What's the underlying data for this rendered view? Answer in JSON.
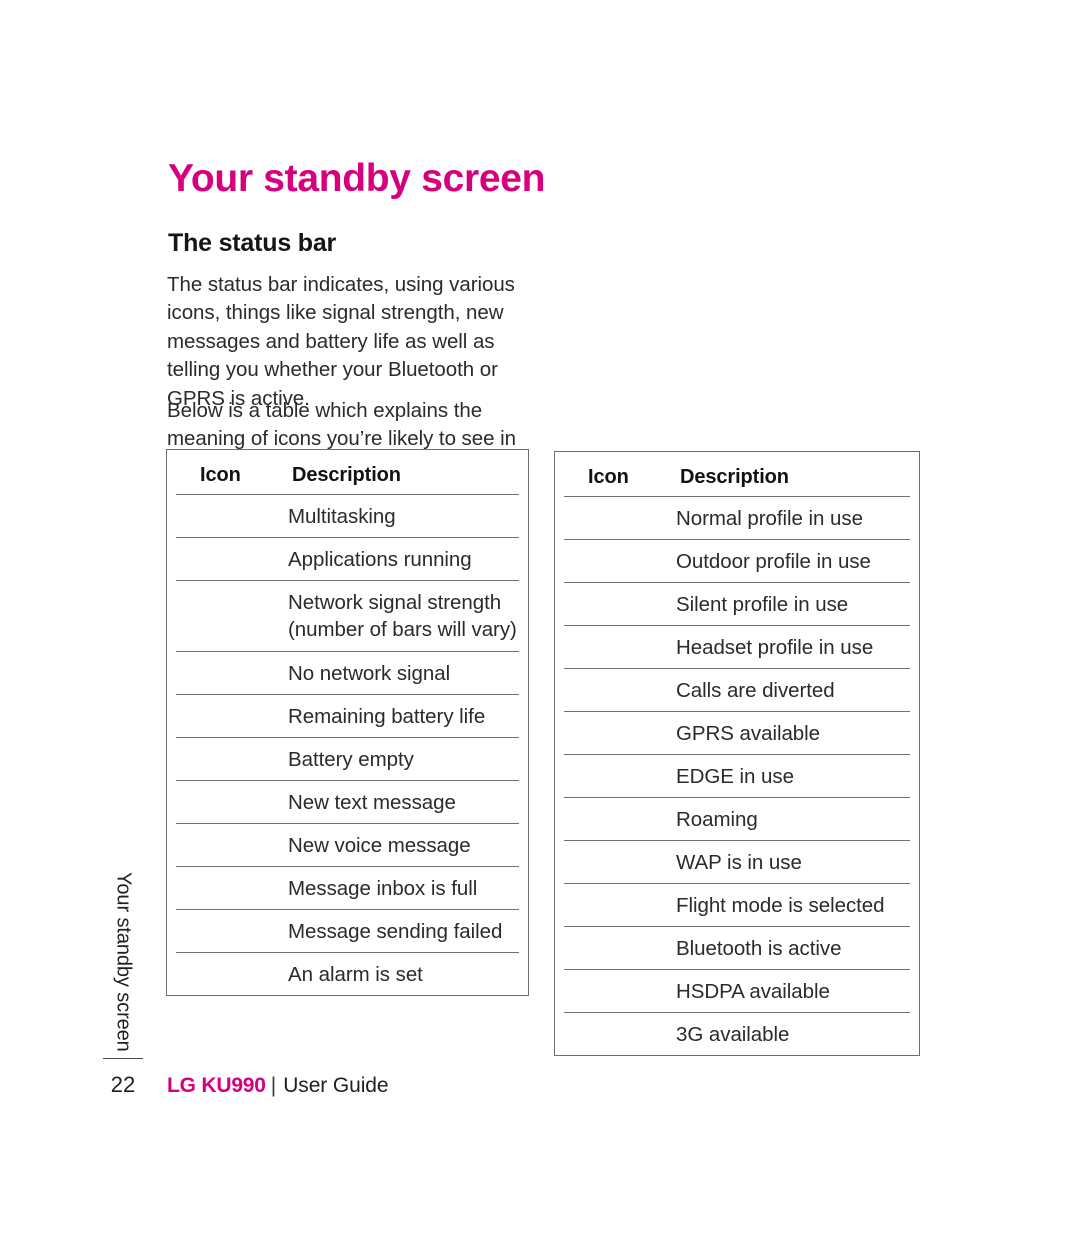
{
  "document": {
    "title": "Your standby screen",
    "section_heading": "The status bar",
    "paragraphs": [
      "The status bar indicates, using various icons, things like signal strength, new messages and battery life as well as telling you whether your Bluetooth or GPRS is active.",
      "Below is a table which explains the meaning of icons you’re likely to see in the status bar."
    ],
    "accent_color": "#d6007f",
    "text_color": "#2b2b2b"
  },
  "side_tab": {
    "label": "Your standby screen"
  },
  "footer": {
    "page_number": "22",
    "brand": "LG KU990",
    "separator": "|",
    "guide_label": "User Guide"
  },
  "tables": [
    {
      "id": "status-icons-left",
      "headers": {
        "icon": "Icon",
        "description": "Description"
      },
      "rows": [
        {
          "icon": "multitasking-icon",
          "description": "Multitasking"
        },
        {
          "icon": "applications-running-icon",
          "description": "Applications running"
        },
        {
          "icon": "signal-strength-icon",
          "description": "Network signal strength",
          "description_line2": "(number of bars will vary)"
        },
        {
          "icon": "no-signal-icon",
          "description": "No network signal"
        },
        {
          "icon": "battery-level-icon",
          "description": "Remaining battery life"
        },
        {
          "icon": "battery-empty-icon",
          "description": "Battery empty"
        },
        {
          "icon": "new-text-message-icon",
          "description": "New text message"
        },
        {
          "icon": "new-voice-message-icon",
          "description": "New voice message"
        },
        {
          "icon": "inbox-full-icon",
          "description": "Message inbox is full"
        },
        {
          "icon": "message-failed-icon",
          "description": "Message sending failed"
        },
        {
          "icon": "alarm-icon",
          "description": "An alarm is set"
        }
      ]
    },
    {
      "id": "status-icons-right",
      "headers": {
        "icon": "Icon",
        "description": "Description"
      },
      "rows": [
        {
          "icon": "normal-profile-icon",
          "description": "Normal profile in use"
        },
        {
          "icon": "outdoor-profile-icon",
          "description": "Outdoor profile in use"
        },
        {
          "icon": "silent-profile-icon",
          "description": "Silent profile in use"
        },
        {
          "icon": "headset-profile-icon",
          "description": "Headset profile in use"
        },
        {
          "icon": "call-divert-icon",
          "description": "Calls are diverted"
        },
        {
          "icon": "gprs-icon",
          "description": "GPRS available"
        },
        {
          "icon": "edge-icon",
          "description": "EDGE in use"
        },
        {
          "icon": "roaming-icon",
          "description": "Roaming"
        },
        {
          "icon": "wap-icon",
          "description": "WAP is in use"
        },
        {
          "icon": "flight-mode-icon",
          "description": "Flight mode is selected"
        },
        {
          "icon": "bluetooth-icon",
          "description": "Bluetooth is active"
        },
        {
          "icon": "hsdpa-icon",
          "description": "HSDPA available"
        },
        {
          "icon": "3g-icon",
          "description": "3G available"
        }
      ]
    }
  ]
}
